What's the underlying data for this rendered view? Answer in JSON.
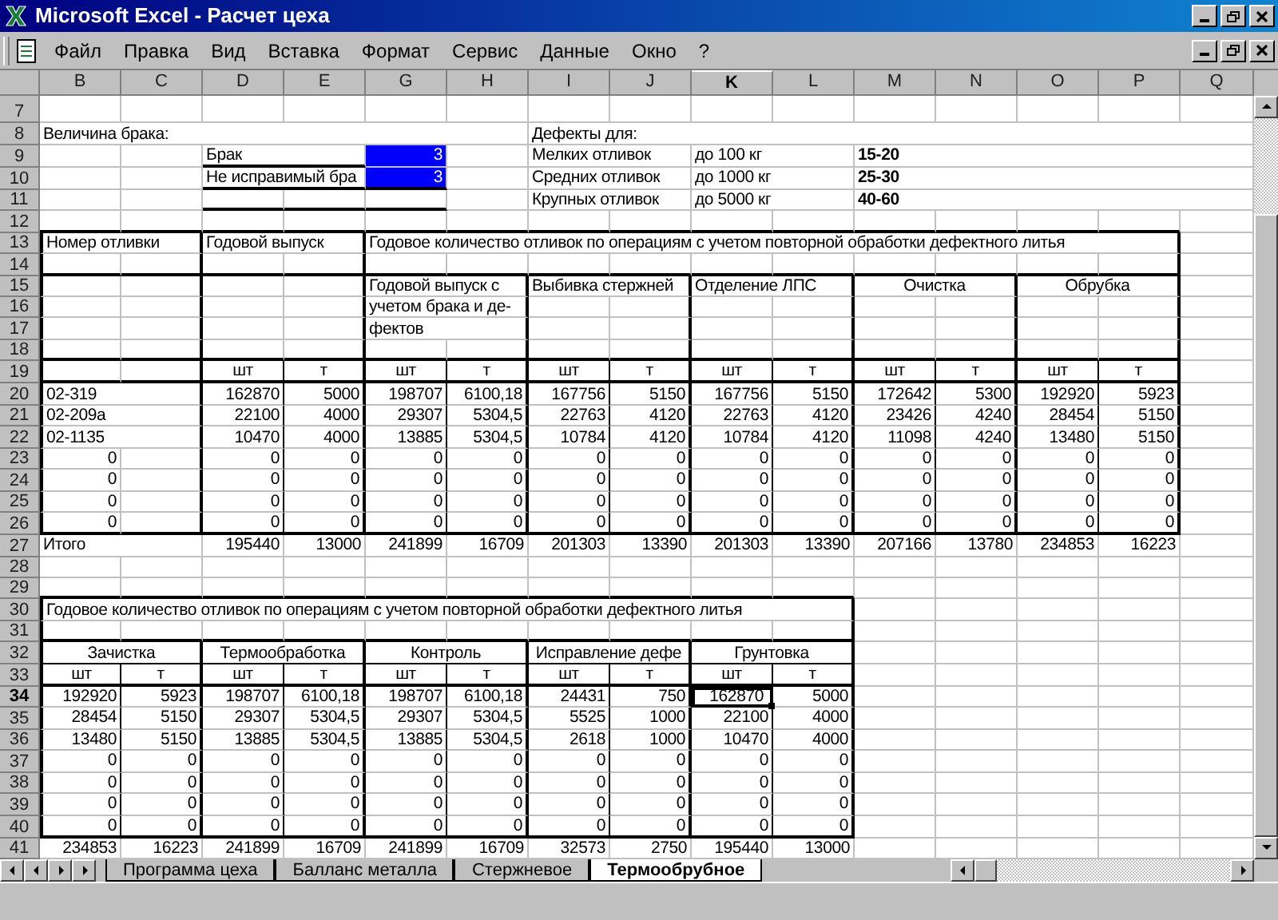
{
  "window": {
    "title": "Microsoft Excel - Расчет цеха"
  },
  "menu": [
    "Файл",
    "Правка",
    "Вид",
    "Вставка",
    "Формат",
    "Сервис",
    "Данные",
    "Окно",
    "?"
  ],
  "sheet": {
    "columns": [
      {
        "label": "B",
        "selected": false
      },
      {
        "label": "C",
        "selected": false
      },
      {
        "label": "D",
        "selected": false
      },
      {
        "label": "E",
        "selected": false
      },
      {
        "label": "G",
        "selected": false
      },
      {
        "label": "H",
        "selected": false
      },
      {
        "label": "I",
        "selected": false
      },
      {
        "label": "J",
        "selected": false
      },
      {
        "label": "K",
        "selected": true
      },
      {
        "label": "L",
        "selected": false
      },
      {
        "label": "M",
        "selected": false
      },
      {
        "label": "N",
        "selected": false
      },
      {
        "label": "O",
        "selected": false
      },
      {
        "label": "P",
        "selected": false
      },
      {
        "label": "Q",
        "selected": false
      }
    ],
    "rows": [
      {
        "header": "7",
        "selected": false,
        "cells": []
      },
      {
        "header": "8",
        "selected": false,
        "cells": [
          {
            "kind": "text",
            "text": "Величина брака:"
          },
          null,
          null,
          null,
          null,
          null,
          {
            "kind": "text",
            "text": "Дефекты для:"
          }
        ]
      },
      {
        "header": "9",
        "selected": false,
        "cells": [
          null,
          null,
          {
            "kind": "text",
            "text": "Брак"
          },
          null,
          {
            "kind": "value",
            "text": "3",
            "color": "#0000ff"
          },
          null,
          {
            "kind": "text",
            "text": "Мелких отливок"
          },
          null,
          {
            "kind": "text",
            "text": "до 100 кг"
          },
          null,
          {
            "kind": "text",
            "text": "15-20",
            "bold": true
          }
        ]
      },
      {
        "header": "10",
        "selected": false,
        "cells": [
          null,
          null,
          {
            "kind": "text",
            "text": "Не исправимый бра"
          },
          null,
          {
            "kind": "value",
            "text": "3",
            "color": "#0000ff"
          },
          null,
          {
            "kind": "text",
            "text": "Средних отливок"
          },
          null,
          {
            "kind": "text",
            "text": "до 1000 кг"
          },
          null,
          {
            "kind": "text",
            "text": "25-30",
            "bold": true
          }
        ]
      },
      {
        "header": "11",
        "selected": false,
        "cells": [
          null,
          null,
          null,
          null,
          null,
          null,
          {
            "kind": "text",
            "text": "Крупных отливок"
          },
          null,
          {
            "kind": "text",
            "text": "до 5000 кг"
          },
          null,
          {
            "kind": "text",
            "text": "40-60",
            "bold": true
          }
        ]
      },
      {
        "header": "12",
        "selected": false,
        "cells": []
      },
      {
        "header": "13",
        "selected": false,
        "cells": [
          {
            "kind": "text",
            "text": "Номер отливки"
          },
          null,
          {
            "kind": "text",
            "text": "Годовой выпуск"
          },
          null,
          {
            "kind": "text",
            "text": "Годовое количество отливок по операциям с учетом повторной обработки дефектного литья"
          }
        ]
      },
      {
        "header": "14",
        "selected": false,
        "cells": []
      },
      {
        "header": "15",
        "selected": false,
        "cells": [
          null,
          null,
          null,
          null,
          {
            "kind": "text",
            "text": "Годовой выпуск с"
          },
          null,
          {
            "kind": "text",
            "text": "Выбивка стержней"
          },
          null,
          {
            "kind": "text",
            "text": "Отделение ЛПС"
          },
          null,
          {
            "kind": "heading",
            "text": "Очистка"
          },
          {
            "kind": "merged"
          },
          {
            "kind": "heading",
            "text": "Обрубка"
          },
          {
            "kind": "merged"
          }
        ]
      },
      {
        "header": "16",
        "selected": false,
        "cells": [
          null,
          null,
          null,
          null,
          {
            "kind": "text",
            "text": "учетом брака и де-"
          }
        ]
      },
      {
        "header": "17",
        "selected": false,
        "cells": [
          null,
          null,
          null,
          null,
          {
            "kind": "text",
            "text": "фектов"
          }
        ]
      },
      {
        "header": "18",
        "selected": false,
        "cells": []
      },
      {
        "header": "19",
        "selected": false,
        "cells": [
          null,
          null,
          {
            "kind": "heading",
            "text": "шт"
          },
          {
            "kind": "heading",
            "text": "т"
          },
          {
            "kind": "heading",
            "text": "шт"
          },
          {
            "kind": "heading",
            "text": "т"
          },
          {
            "kind": "heading",
            "text": "шт"
          },
          {
            "kind": "heading",
            "text": "т"
          },
          {
            "kind": "heading",
            "text": "шт"
          },
          {
            "kind": "heading",
            "text": "т"
          },
          {
            "kind": "heading",
            "text": "шт"
          },
          {
            "kind": "heading",
            "text": "т"
          },
          {
            "kind": "heading",
            "text": "шт"
          },
          {
            "kind": "heading",
            "text": "т"
          }
        ]
      },
      {
        "header": "20",
        "selected": false,
        "cells": [
          {
            "kind": "text",
            "text": "02-319"
          },
          null,
          "162870",
          "5000",
          "198707",
          "6100,18",
          "167756",
          "5150",
          "167756",
          "5150",
          "172642",
          "5300",
          "192920",
          "5923"
        ]
      },
      {
        "header": "21",
        "selected": false,
        "cells": [
          {
            "kind": "text",
            "text": "02-209а"
          },
          null,
          "22100",
          "4000",
          "29307",
          "5304,5",
          "22763",
          "4120",
          "22763",
          "4120",
          "23426",
          "4240",
          "28454",
          "5150"
        ]
      },
      {
        "header": "22",
        "selected": false,
        "cells": [
          {
            "kind": "text",
            "text": "02-1135"
          },
          null,
          "10470",
          "4000",
          "13885",
          "5304,5",
          "10784",
          "4120",
          "10784",
          "4120",
          "11098",
          "4240",
          "13480",
          "5150"
        ]
      },
      {
        "header": "23",
        "selected": false,
        "cells": [
          "0",
          null,
          "0",
          "0",
          "0",
          "0",
          "0",
          "0",
          "0",
          "0",
          "0",
          "0",
          "0",
          "0"
        ]
      },
      {
        "header": "24",
        "selected": false,
        "cells": [
          "0",
          null,
          "0",
          "0",
          "0",
          "0",
          "0",
          "0",
          "0",
          "0",
          "0",
          "0",
          "0",
          "0"
        ]
      },
      {
        "header": "25",
        "selected": false,
        "cells": [
          "0",
          null,
          "0",
          "0",
          "0",
          "0",
          "0",
          "0",
          "0",
          "0",
          "0",
          "0",
          "0",
          "0"
        ]
      },
      {
        "header": "26",
        "selected": false,
        "cells": [
          "0",
          null,
          "0",
          "0",
          "0",
          "0",
          "0",
          "0",
          "0",
          "0",
          "0",
          "0",
          "0",
          "0"
        ]
      },
      {
        "header": "27",
        "selected": false,
        "cells": [
          {
            "kind": "text",
            "text": "Итого"
          },
          null,
          "195440",
          "13000",
          "241899",
          "16709",
          "201303",
          "13390",
          "201303",
          "13390",
          "207166",
          "13780",
          "234853",
          "16223"
        ]
      },
      {
        "header": "28",
        "selected": false,
        "cells": []
      },
      {
        "header": "29",
        "selected": false,
        "cells": []
      },
      {
        "header": "30",
        "selected": false,
        "cells": [
          {
            "kind": "text",
            "text": "Годовое количество отливок по операциям с учетом повторной обработки дефектного литья"
          }
        ]
      },
      {
        "header": "31",
        "selected": false,
        "cells": []
      },
      {
        "header": "32",
        "selected": false,
        "cells": [
          {
            "kind": "heading",
            "text": "Зачистка"
          },
          {
            "kind": "merged"
          },
          {
            "kind": "heading",
            "text": "Термообработка"
          },
          {
            "kind": "merged"
          },
          {
            "kind": "heading",
            "text": "Контроль"
          },
          {
            "kind": "merged"
          },
          {
            "kind": "heading",
            "text": "Исправление дефе"
          },
          {
            "kind": "merged"
          },
          {
            "kind": "heading",
            "text": "Грунтовка"
          },
          {
            "kind": "merged"
          }
        ]
      },
      {
        "header": "33",
        "selected": false,
        "cells": [
          {
            "kind": "heading",
            "text": "шт"
          },
          {
            "kind": "heading",
            "text": "т"
          },
          {
            "kind": "heading",
            "text": "шт"
          },
          {
            "kind": "heading",
            "text": "т"
          },
          {
            "kind": "heading",
            "text": "шт"
          },
          {
            "kind": "heading",
            "text": "т"
          },
          {
            "kind": "heading",
            "text": "шт"
          },
          {
            "kind": "heading",
            "text": "т"
          },
          {
            "kind": "heading",
            "text": "шт"
          },
          {
            "kind": "heading",
            "text": "т"
          }
        ]
      },
      {
        "header": "34",
        "selected": true,
        "cells": [
          "192920",
          "5923",
          "198707",
          "6100,18",
          "198707",
          "6100,18",
          "24431",
          "750",
          "162870",
          "5000"
        ]
      },
      {
        "header": "35",
        "selected": false,
        "cells": [
          "28454",
          "5150",
          "29307",
          "5304,5",
          "29307",
          "5304,5",
          "5525",
          "1000",
          "22100",
          "4000"
        ]
      },
      {
        "header": "36",
        "selected": false,
        "cells": [
          "13480",
          "5150",
          "13885",
          "5304,5",
          "13885",
          "5304,5",
          "2618",
          "1000",
          "10470",
          "4000"
        ]
      },
      {
        "header": "37",
        "selected": false,
        "cells": [
          "0",
          "0",
          "0",
          "0",
          "0",
          "0",
          "0",
          "0",
          "0",
          "0"
        ]
      },
      {
        "header": "38",
        "selected": false,
        "cells": [
          "0",
          "0",
          "0",
          "0",
          "0",
          "0",
          "0",
          "0",
          "0",
          "0"
        ]
      },
      {
        "header": "39",
        "selected": false,
        "cells": [
          "0",
          "0",
          "0",
          "0",
          "0",
          "0",
          "0",
          "0",
          "0",
          "0"
        ]
      },
      {
        "header": "40",
        "selected": false,
        "cells": [
          "0",
          "0",
          "0",
          "0",
          "0",
          "0",
          "0",
          "0",
          "0",
          "0"
        ]
      },
      {
        "header": "41",
        "selected": false,
        "cells": [
          "234853",
          "16223",
          "241899",
          "16709",
          "241899",
          "16709",
          "32573",
          "2750",
          "195440",
          "13000"
        ]
      }
    ]
  },
  "tabs": [
    {
      "label": "Программа цеха",
      "selected": false
    },
    {
      "label": "Балланс металла",
      "selected": false
    },
    {
      "label": "Стержневое",
      "selected": false
    },
    {
      "label": "Термообрубное",
      "selected": true
    }
  ]
}
